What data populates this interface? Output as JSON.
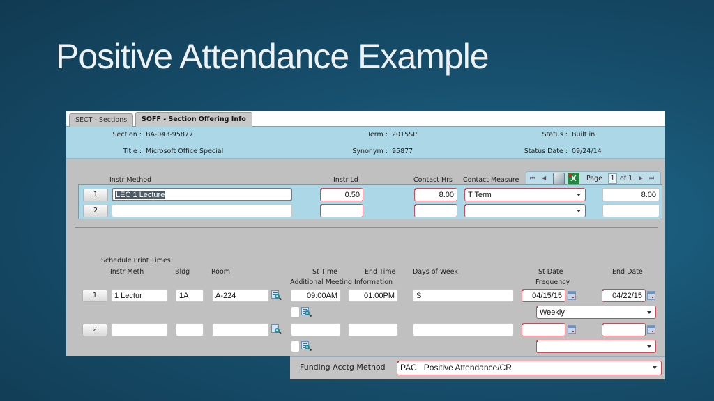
{
  "slide": {
    "title": "Positive Attendance Example"
  },
  "tabs": [
    {
      "label": "SECT - Sections",
      "active": false
    },
    {
      "label": "SOFF - Section Offering Info",
      "active": true
    }
  ],
  "header": {
    "section_label": "Section :",
    "section_value": "BA-043-95877",
    "title_label": "Title :",
    "title_value": "Microsoft Office Special",
    "term_label": "Term :",
    "term_value": "2015SP",
    "synonym_label": "Synonym :",
    "synonym_value": "95877",
    "status_label": "Status :",
    "status_value": "Built in",
    "status_date_label": "Status Date :",
    "status_date_value": "09/24/14"
  },
  "instr_grid": {
    "columns": {
      "instr_method": "Instr Method",
      "instr_ld": "Instr Ld",
      "contact_hrs": "Contact Hrs",
      "contact_measure": "Contact Measure"
    },
    "rows": [
      {
        "row": "1",
        "instr_method": "LEC 1 Lecture",
        "instr_ld": "0.50",
        "contact_hrs": "8.00",
        "contact_measure": "T Term",
        "extra": "8.00"
      },
      {
        "row": "2",
        "instr_method": "",
        "instr_ld": "",
        "contact_hrs": "",
        "contact_measure": "",
        "extra": ""
      }
    ],
    "pager": {
      "page_label": "Page",
      "page": "1",
      "of_label": "of 1",
      "first": "⏮",
      "prev": "◀",
      "next": "▶",
      "last": "⏭",
      "export_icon": "excel-icon"
    }
  },
  "schedule": {
    "section_label": "Schedule Print Times",
    "columns": {
      "instr_meth": "Instr Meth",
      "bldg": "Bldg",
      "room": "Room",
      "st_time": "St Time",
      "end_time": "End Time",
      "additional": "Additional Meeting Information",
      "days": "Days of Week",
      "st_date": "St Date",
      "frequency": "Frequency",
      "end_date": "End Date"
    },
    "rows": [
      {
        "row": "1",
        "instr_meth": "1 Lectur",
        "bldg": "1A",
        "room": "A-224",
        "st_time": "09:00AM",
        "end_time": "01:00PM",
        "days": "S",
        "st_date": "04/15/15",
        "end_date": "04/22/15",
        "frequency": "Weekly"
      },
      {
        "row": "2",
        "instr_meth": "",
        "bldg": "",
        "room": "",
        "st_time": "",
        "end_time": "",
        "days": "",
        "st_date": "",
        "end_date": "",
        "frequency": ""
      }
    ]
  },
  "funding": {
    "label": "Funding Acctg Method",
    "value": "PAC   Positive Attendance/CR"
  }
}
